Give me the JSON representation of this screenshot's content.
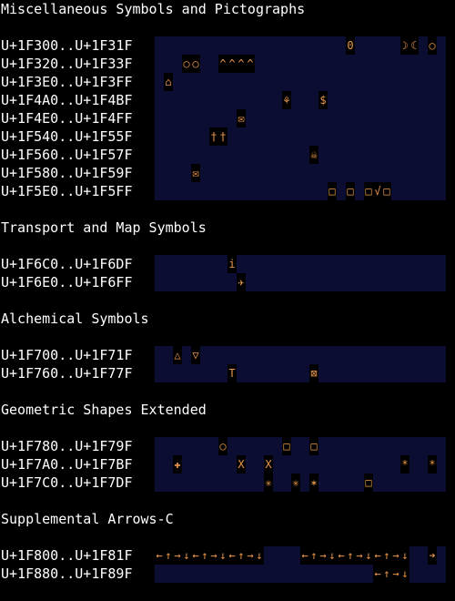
{
  "colors": {
    "background": "#000000",
    "row_band": "#0b0d33",
    "label_text": "#ffffff",
    "glyph": "#e8964a"
  },
  "sections": [
    {
      "title": "Miscellaneous Symbols and Pictographs",
      "rows": [
        {
          "label": "U+1F300..U+1F31F",
          "glyphs": [
            {
              "col": 21,
              "char": "0"
            },
            {
              "col": 27,
              "char": "☽"
            },
            {
              "col": 28,
              "char": "☾"
            },
            {
              "col": 30,
              "char": "○"
            }
          ]
        },
        {
          "label": "U+1F320..U+1F33F",
          "glyphs": [
            {
              "col": 3,
              "char": "○"
            },
            {
              "col": 4,
              "char": "○"
            },
            {
              "col": 7,
              "char": "^"
            },
            {
              "col": 8,
              "char": "^"
            },
            {
              "col": 9,
              "char": "^"
            },
            {
              "col": 10,
              "char": "^"
            }
          ]
        },
        {
          "label": "U+1F3E0..U+1F3FF",
          "glyphs": [
            {
              "col": 1,
              "char": "⌂"
            }
          ]
        },
        {
          "label": "U+1F4A0..U+1F4BF",
          "glyphs": [
            {
              "col": 14,
              "char": "⚘"
            },
            {
              "col": 18,
              "char": "$"
            }
          ]
        },
        {
          "label": "U+1F4E0..U+1F4FF",
          "glyphs": [
            {
              "col": 9,
              "char": "✉"
            }
          ]
        },
        {
          "label": "U+1F540..U+1F55F",
          "glyphs": [
            {
              "col": 6,
              "char": "†"
            },
            {
              "col": 7,
              "char": "†"
            }
          ]
        },
        {
          "label": "U+1F560..U+1F57F",
          "glyphs": [
            {
              "col": 17,
              "char": "☠"
            }
          ]
        },
        {
          "label": "U+1F580..U+1F59F",
          "glyphs": [
            {
              "col": 4,
              "char": "✉"
            }
          ]
        },
        {
          "label": "U+1F5E0..U+1F5FF",
          "glyphs": [
            {
              "col": 19,
              "char": "□"
            },
            {
              "col": 21,
              "char": "□"
            },
            {
              "col": 23,
              "char": "□"
            },
            {
              "col": 24,
              "char": "√"
            },
            {
              "col": 25,
              "char": "□"
            }
          ]
        }
      ]
    },
    {
      "title": "Transport and Map Symbols",
      "rows": [
        {
          "label": "U+1F6C0..U+1F6DF",
          "glyphs": [
            {
              "col": 8,
              "char": "i"
            }
          ]
        },
        {
          "label": "U+1F6E0..U+1F6FF",
          "glyphs": [
            {
              "col": 9,
              "char": "✈"
            }
          ]
        }
      ]
    },
    {
      "title": "Alchemical Symbols",
      "rows": [
        {
          "label": "U+1F700..U+1F71F",
          "glyphs": [
            {
              "col": 2,
              "char": "△"
            },
            {
              "col": 4,
              "char": "▽"
            }
          ]
        },
        {
          "label": "U+1F760..U+1F77F",
          "glyphs": [
            {
              "col": 8,
              "char": "T"
            },
            {
              "col": 17,
              "char": "⊠"
            }
          ]
        }
      ]
    },
    {
      "title": "Geometric Shapes Extended",
      "rows": [
        {
          "label": "U+1F780..U+1F79F",
          "glyphs": [
            {
              "col": 7,
              "char": "○"
            },
            {
              "col": 14,
              "char": "□"
            },
            {
              "col": 17,
              "char": "□"
            }
          ]
        },
        {
          "label": "U+1F7A0..U+1F7BF",
          "glyphs": [
            {
              "col": 2,
              "char": "✚"
            },
            {
              "col": 9,
              "char": "X"
            },
            {
              "col": 12,
              "char": "X"
            },
            {
              "col": 27,
              "char": "*"
            },
            {
              "col": 30,
              "char": "*"
            }
          ]
        },
        {
          "label": "U+1F7C0..U+1F7DF",
          "glyphs": [
            {
              "col": 12,
              "char": "✳"
            },
            {
              "col": 15,
              "char": "✳"
            },
            {
              "col": 17,
              "char": "✶"
            },
            {
              "col": 23,
              "char": "□"
            }
          ]
        }
      ]
    },
    {
      "title": "Supplemental Arrows-C",
      "rows": [
        {
          "label": "U+1F800..U+1F81F",
          "glyphs": [
            {
              "col": 0,
              "char": "←"
            },
            {
              "col": 1,
              "char": "↑"
            },
            {
              "col": 2,
              "char": "→"
            },
            {
              "col": 3,
              "char": "↓"
            },
            {
              "col": 4,
              "char": "←"
            },
            {
              "col": 5,
              "char": "↑"
            },
            {
              "col": 6,
              "char": "→"
            },
            {
              "col": 7,
              "char": "↓"
            },
            {
              "col": 8,
              "char": "←"
            },
            {
              "col": 9,
              "char": "↑"
            },
            {
              "col": 10,
              "char": "→"
            },
            {
              "col": 11,
              "char": "↓"
            },
            {
              "col": 16,
              "char": "←"
            },
            {
              "col": 17,
              "char": "↑"
            },
            {
              "col": 18,
              "char": "→"
            },
            {
              "col": 19,
              "char": "↓"
            },
            {
              "col": 20,
              "char": "←"
            },
            {
              "col": 21,
              "char": "↑"
            },
            {
              "col": 22,
              "char": "→"
            },
            {
              "col": 23,
              "char": "↓"
            },
            {
              "col": 24,
              "char": "←"
            },
            {
              "col": 25,
              "char": "↑"
            },
            {
              "col": 26,
              "char": "→"
            },
            {
              "col": 27,
              "char": "↓"
            },
            {
              "col": 30,
              "char": "➔"
            }
          ]
        },
        {
          "label": "U+1F880..U+1F89F",
          "glyphs": [
            {
              "col": 24,
              "char": "←"
            },
            {
              "col": 25,
              "char": "↑"
            },
            {
              "col": 26,
              "char": "→"
            },
            {
              "col": 27,
              "char": "↓"
            }
          ]
        }
      ]
    }
  ]
}
